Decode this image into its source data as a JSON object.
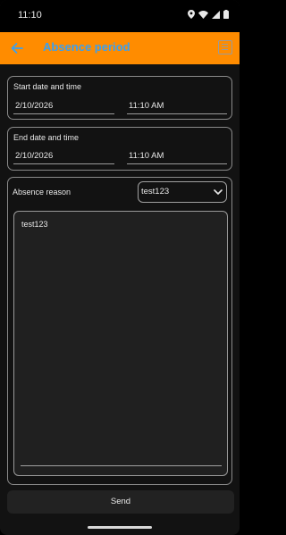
{
  "status_bar": {
    "time": "11:10"
  },
  "app_bar": {
    "title": "Absence period",
    "back_icon": "arrow-left-icon",
    "menu_icon": "list-icon"
  },
  "start_section": {
    "label": "Start date and time",
    "date": "2/10/2026",
    "time": "11:10 AM"
  },
  "end_section": {
    "label": "End date and time",
    "date": "2/10/2026",
    "time": "11:10 AM"
  },
  "reason_section": {
    "label": "Absence reason",
    "selected": "test123",
    "notes": "test123"
  },
  "actions": {
    "send_label": "Send"
  },
  "colors": {
    "app_bar": "#ff8c00",
    "title": "#3aa0f0",
    "background": "#121212",
    "text": "#e8e8e8"
  }
}
